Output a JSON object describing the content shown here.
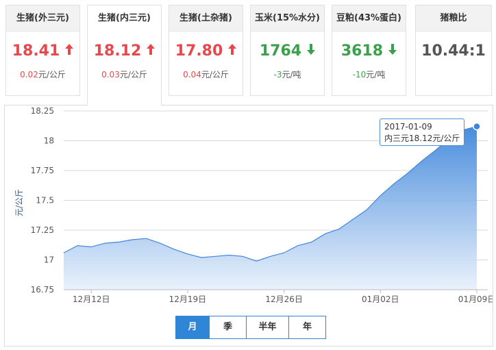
{
  "cards": [
    {
      "title": "生猪(外三元)",
      "price": "18.41",
      "direction": "up",
      "change_value": "0.02",
      "change_unit": "元/公斤"
    },
    {
      "title": "生猪(内三元)",
      "price": "18.12",
      "direction": "up",
      "change_value": "0.03",
      "change_unit": "元/公斤",
      "active": true
    },
    {
      "title": "生猪(土杂猪)",
      "price": "17.80",
      "direction": "up",
      "change_value": "0.04",
      "change_unit": "元/公斤"
    },
    {
      "title": "玉米(15%水分)",
      "price": "1764",
      "direction": "down",
      "change_value": "-3",
      "change_unit": "元/吨"
    },
    {
      "title": "豆粕(43%蛋白)",
      "price": "3618",
      "direction": "down",
      "change_value": "-10",
      "change_unit": "元/吨"
    },
    {
      "title": "猪粮比",
      "price": "10.44:1",
      "direction": "none"
    }
  ],
  "colors": {
    "up": "#e5484d",
    "down": "#3aa14b",
    "accent": "#2f86d6",
    "area_top": "#3f86db",
    "area_bottom": "#e7f0fb"
  },
  "tooltip": {
    "date": "2017-01-09",
    "text": "内三元18.12元/公斤"
  },
  "tabs": [
    "月",
    "季",
    "半年",
    "年"
  ],
  "active_tab": "月",
  "chart_data": {
    "type": "area",
    "ylabel": "元/公斤",
    "ylim": [
      16.75,
      18.25
    ],
    "y_ticks": [
      "18.25",
      "18",
      "17.75",
      "17.5",
      "17.25",
      "17",
      "16.75"
    ],
    "x_ticks": [
      "12月12日",
      "12月19日",
      "12月26日",
      "01月02日",
      "01月09日"
    ],
    "grid": true,
    "series": [
      {
        "values": [
          {
            "x": "2016-12-10",
            "y": 17.06
          },
          {
            "x": "2016-12-11",
            "y": 17.12
          },
          {
            "x": "2016-12-12",
            "y": 17.11
          },
          {
            "x": "2016-12-13",
            "y": 17.14
          },
          {
            "x": "2016-12-14",
            "y": 17.15
          },
          {
            "x": "2016-12-15",
            "y": 17.17
          },
          {
            "x": "2016-12-16",
            "y": 17.18
          },
          {
            "x": "2016-12-17",
            "y": 17.14
          },
          {
            "x": "2016-12-18",
            "y": 17.09
          },
          {
            "x": "2016-12-19",
            "y": 17.05
          },
          {
            "x": "2016-12-20",
            "y": 17.02
          },
          {
            "x": "2016-12-21",
            "y": 17.03
          },
          {
            "x": "2016-12-22",
            "y": 17.04
          },
          {
            "x": "2016-12-23",
            "y": 17.03
          },
          {
            "x": "2016-12-24",
            "y": 16.99
          },
          {
            "x": "2016-12-25",
            "y": 17.03
          },
          {
            "x": "2016-12-26",
            "y": 17.06
          },
          {
            "x": "2016-12-27",
            "y": 17.12
          },
          {
            "x": "2016-12-28",
            "y": 17.15
          },
          {
            "x": "2016-12-29",
            "y": 17.22
          },
          {
            "x": "2016-12-30",
            "y": 17.26
          },
          {
            "x": "2016-12-31",
            "y": 17.34
          },
          {
            "x": "2017-01-01",
            "y": 17.42
          },
          {
            "x": "2017-01-02",
            "y": 17.54
          },
          {
            "x": "2017-01-03",
            "y": 17.64
          },
          {
            "x": "2017-01-04",
            "y": 17.73
          },
          {
            "x": "2017-01-05",
            "y": 17.83
          },
          {
            "x": "2017-01-06",
            "y": 17.92
          },
          {
            "x": "2017-01-07",
            "y": 18.02
          },
          {
            "x": "2017-01-08",
            "y": 18.09
          },
          {
            "x": "2017-01-09",
            "y": 18.12
          }
        ]
      }
    ]
  }
}
